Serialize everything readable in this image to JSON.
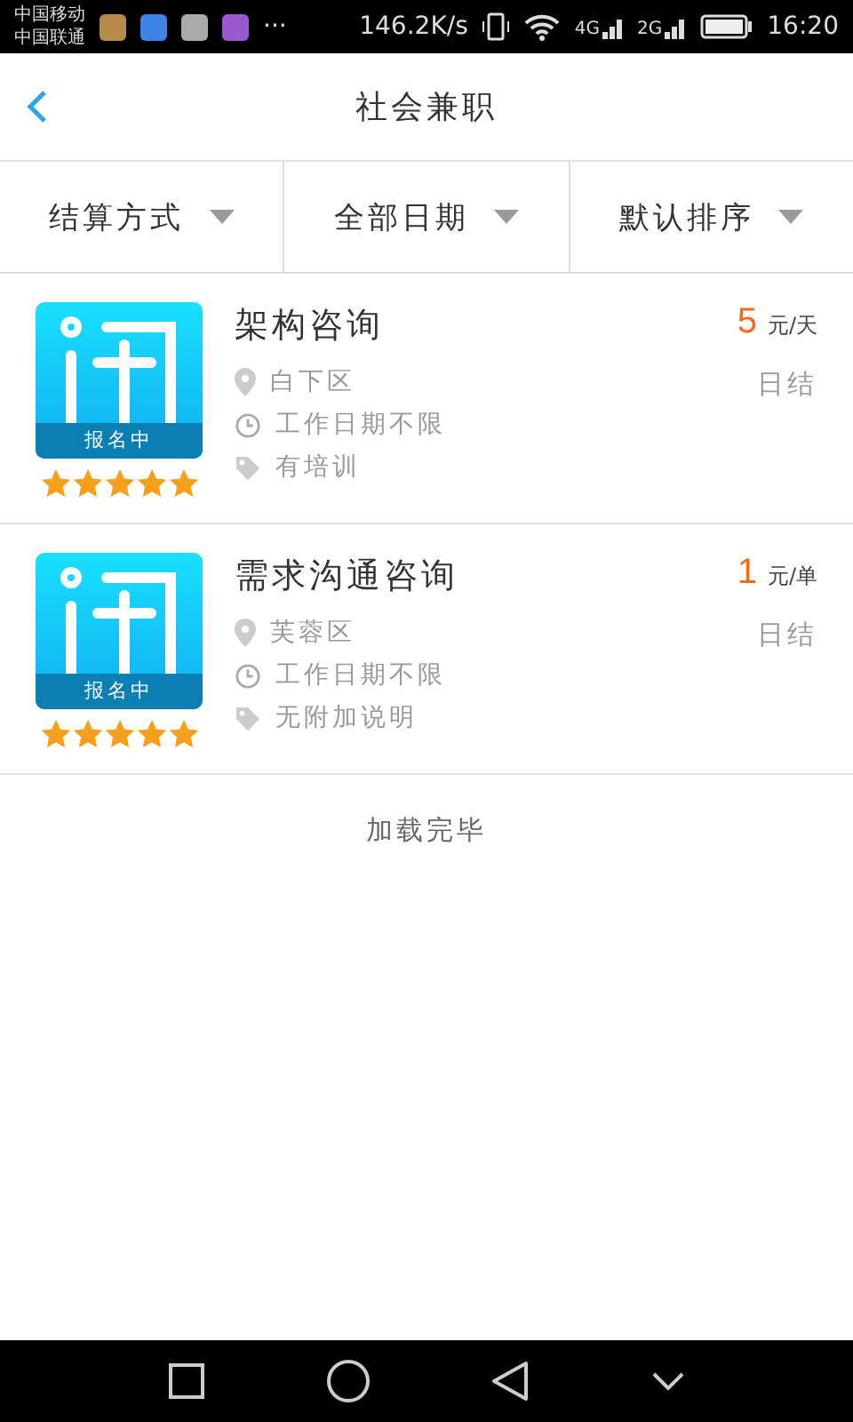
{
  "status_bar": {
    "carriers": [
      "中国移动",
      "中国联通"
    ],
    "more": "···",
    "speed": "146.2K/s",
    "network_1": "4G",
    "network_2": "2G",
    "time": "16:20"
  },
  "header": {
    "title": "社会兼职"
  },
  "filters": [
    {
      "label": "结算方式"
    },
    {
      "label": "全部日期"
    },
    {
      "label": "默认排序"
    }
  ],
  "jobs": [
    {
      "title": "架构咨询",
      "badge": "报名中",
      "stars": 5,
      "price": "5",
      "unit": "元/天",
      "location": "白下区",
      "date": "工作日期不限",
      "note": "有培训",
      "settlement": "日结"
    },
    {
      "title": "需求沟通咨询",
      "badge": "报名中",
      "stars": 5,
      "price": "1",
      "unit": "元/单",
      "location": "芙蓉区",
      "date": "工作日期不限",
      "note": "无附加说明",
      "settlement": "日结"
    }
  ],
  "footer_text": "加载完毕"
}
